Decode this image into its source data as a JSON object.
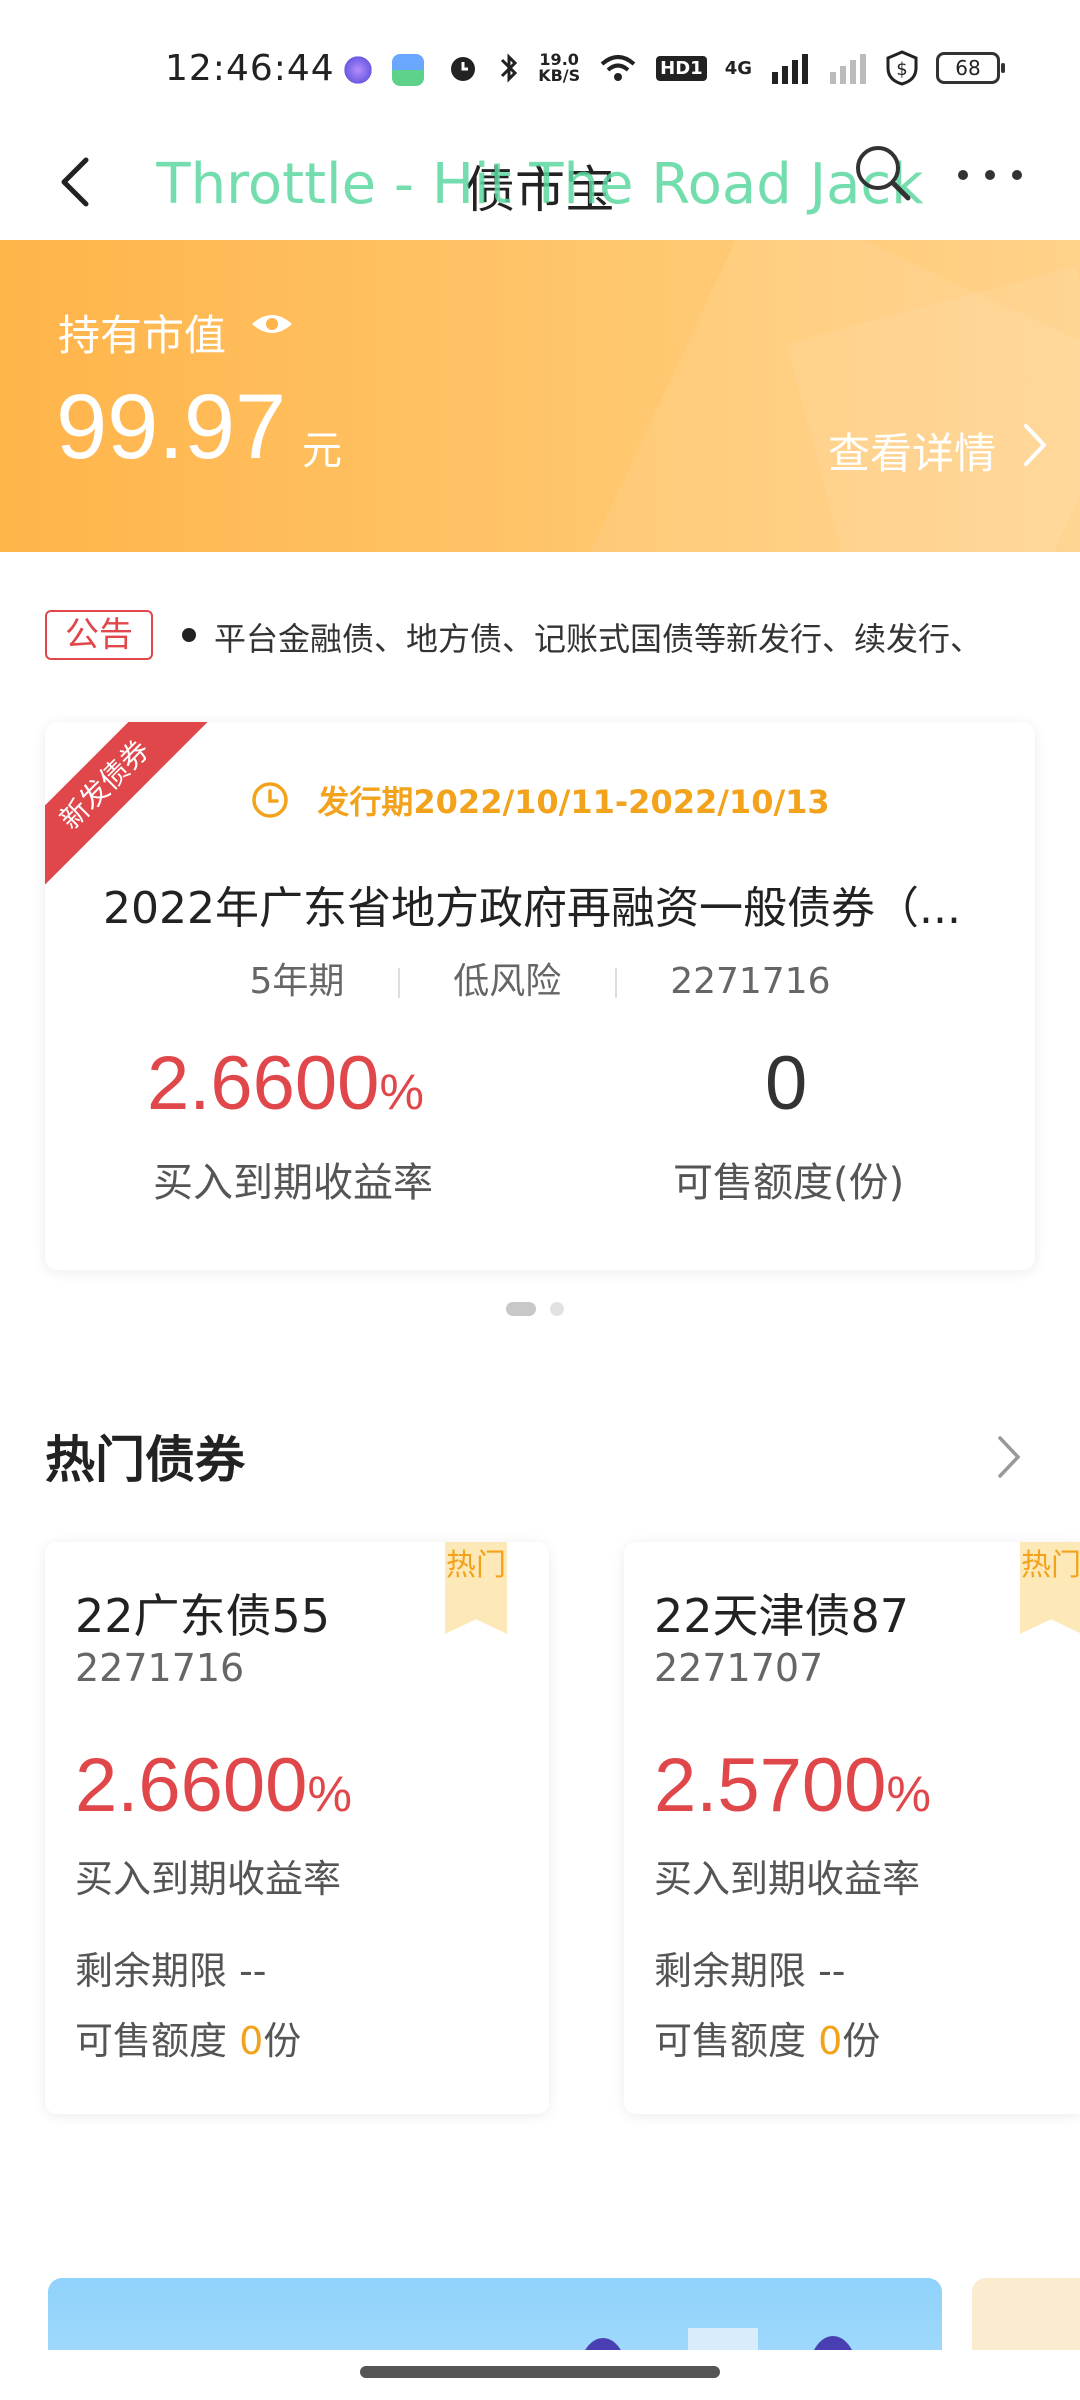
{
  "status_bar": {
    "time": "12:46:44",
    "net_speed_value": "19.0",
    "net_speed_unit": "KB/S",
    "hd_label": "HD1",
    "network_label": "4G",
    "battery": "68"
  },
  "nav": {
    "title": "债市宝",
    "overlay_text": "Throttle - Hit The Road Jack"
  },
  "holdings": {
    "label": "持有市值",
    "value": "99.97",
    "unit": "元",
    "detail_link": "查看详情"
  },
  "notice": {
    "tag": "公告",
    "text": "平台金融债、地方债、记账式国债等新发行、续发行、"
  },
  "new_bond": {
    "ribbon": "新发债券",
    "issue_period": "发行期2022/10/11-2022/10/13",
    "title": "2022年广东省地方政府再融资一般债券（...",
    "term": "5年期",
    "risk": "低风险",
    "code": "2271716",
    "rate": "2.6600",
    "rate_unit": "%",
    "rate_label": "买入到期收益率",
    "quota": "0",
    "quota_label": "可售额度(份)"
  },
  "hot_section": {
    "title": "热门债券",
    "cards": [
      {
        "badge": "热门",
        "name": "22广东债55",
        "code": "2271716",
        "rate": "2.6600",
        "rate_unit": "%",
        "rate_label": "买入到期收益率",
        "term_label": "剩余期限 --",
        "quota_prefix": "可售额度 ",
        "quota_value": "0",
        "quota_suffix": "份"
      },
      {
        "badge": "热门",
        "name": "22天津债87",
        "code": "2271707",
        "rate": "2.5700",
        "rate_unit": "%",
        "rate_label": "买入到期收益率",
        "term_label": "剩余期限 --",
        "quota_prefix": "可售额度 ",
        "quota_value": "0",
        "quota_suffix": "份"
      }
    ]
  },
  "colors": {
    "accent_red": "#e0474b",
    "accent_orange": "#f2a31b",
    "banner_orange": "#ffb44a"
  }
}
